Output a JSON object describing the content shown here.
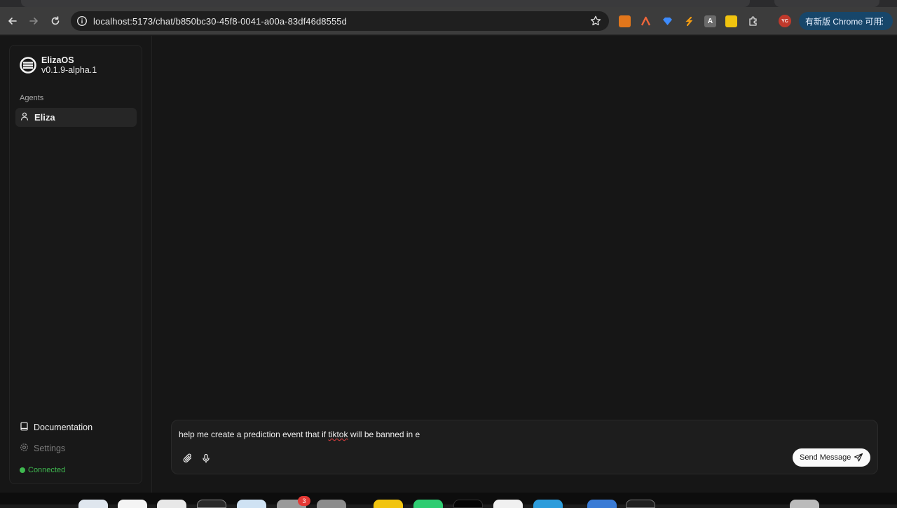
{
  "browser": {
    "url": "localhost:5173/chat/b850bc30-45f8-0041-a00a-83df46d8555d",
    "profile_initials": "YC",
    "update_label": "有新版 Chrome 可用"
  },
  "sidebar": {
    "brand_name": "ElizaOS",
    "brand_version": "v0.1.9-alpha.1",
    "agents_label": "Agents",
    "agents": [
      {
        "label": "Eliza"
      }
    ],
    "documentation_label": "Documentation",
    "settings_label": "Settings",
    "status_label": "Connected"
  },
  "composer": {
    "text_before": "help me create a prediction event that if ",
    "text_misspelled": "tiktok",
    "text_after": " will be banned in e",
    "send_label": "Send Message"
  },
  "dock": {
    "badge_count": "3"
  },
  "colors": {
    "background": "#161616",
    "sidebar": "#181818",
    "status_green": "#3fb950",
    "update_button": "#17466a"
  }
}
